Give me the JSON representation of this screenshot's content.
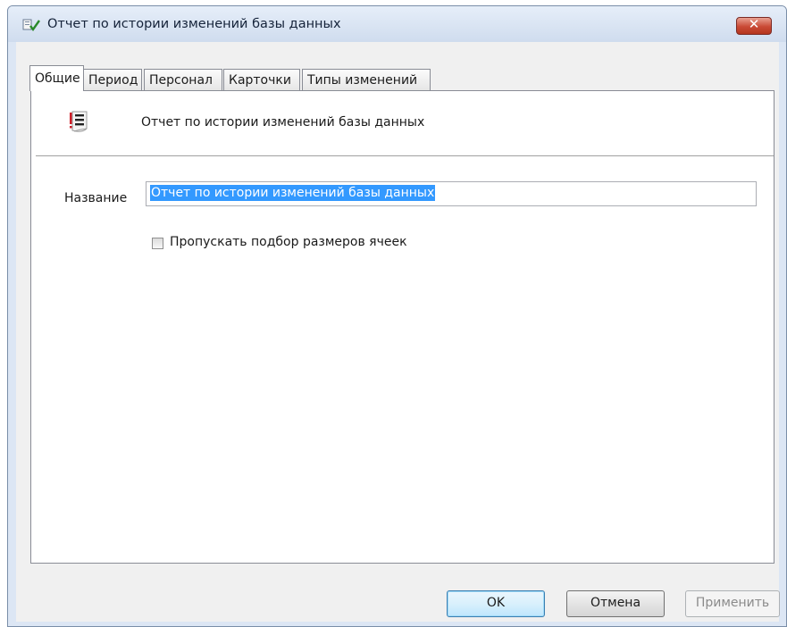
{
  "window": {
    "title": "Отчет по истории изменений базы данных"
  },
  "tabs": [
    {
      "label": "Общие",
      "active": true
    },
    {
      "label": "Период",
      "active": false
    },
    {
      "label": "Персонал",
      "active": false
    },
    {
      "label": "Карточки",
      "active": false
    },
    {
      "label": "Типы изменений",
      "active": false
    }
  ],
  "general": {
    "report_title": "Отчет по истории изменений базы данных",
    "name_label": "Название",
    "name_value": "Отчет по истории изменений базы данных",
    "skip_autofit_label": "Пропускать подбор размеров ячеек",
    "skip_autofit_checked": false
  },
  "buttons": {
    "ok": "OK",
    "cancel": "Отмена",
    "apply": "Применить",
    "apply_enabled": false
  },
  "colors": {
    "selection": "#3399ff",
    "close_button": "#c94a35",
    "icon_accent": "#d0202a"
  }
}
